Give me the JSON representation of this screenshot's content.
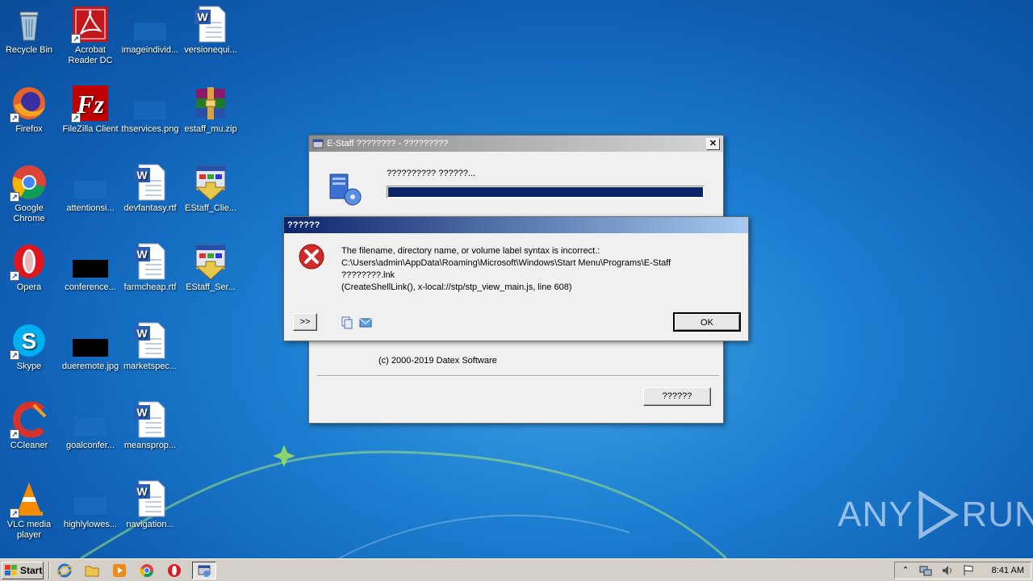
{
  "desktop": {
    "icons": [
      {
        "label": "Recycle Bin"
      },
      {
        "label": "Acrobat Reader DC"
      },
      {
        "label": "imageindivid..."
      },
      {
        "label": "versionequi..."
      },
      {
        "label": "Firefox"
      },
      {
        "label": "FileZilla Client"
      },
      {
        "label": "thservices.png"
      },
      {
        "label": "estaff_mu.zip"
      },
      {
        "label": "Google Chrome"
      },
      {
        "label": "attentionsi..."
      },
      {
        "label": "devfantasy.rtf"
      },
      {
        "label": "EStaff_Clie..."
      },
      {
        "label": "Opera"
      },
      {
        "label": "conference..."
      },
      {
        "label": "farmcheap.rtf"
      },
      {
        "label": "EStaff_Ser..."
      },
      {
        "label": "Skype"
      },
      {
        "label": "dueremote.jpg"
      },
      {
        "label": "marketspec..."
      },
      {
        "label": "CCleaner"
      },
      {
        "label": "goalconfer..."
      },
      {
        "label": "meansprop..."
      },
      {
        "label": "VLC media player"
      },
      {
        "label": "highlylowes..."
      },
      {
        "label": "navigation..."
      }
    ]
  },
  "installer_window": {
    "title": "E-Staff ???????? - ?????????",
    "status_text": "?????????? ??????...",
    "progress_percent": 100,
    "copyright": "(c) 2000-2019 Datex Software",
    "button_label": "??????"
  },
  "error_dialog": {
    "title": "??????",
    "message_line1": "The filename, directory name, or volume label syntax is incorrect.:",
    "message_line2": "C:\\Users\\admin\\AppData\\Roaming\\Microsoft\\Windows\\Start Menu\\Programs\\E-Staff",
    "message_line3": "????????.lnk",
    "message_line4": "(CreateShellLink(),  x-local://stp/stp_view_main.js,   line 608)",
    "details_label": ">>",
    "ok_label": "OK"
  },
  "taskbar": {
    "start_label": "Start",
    "clock": "8:41 AM"
  },
  "watermark": {
    "text_left": "ANY",
    "text_right": "RUN"
  }
}
